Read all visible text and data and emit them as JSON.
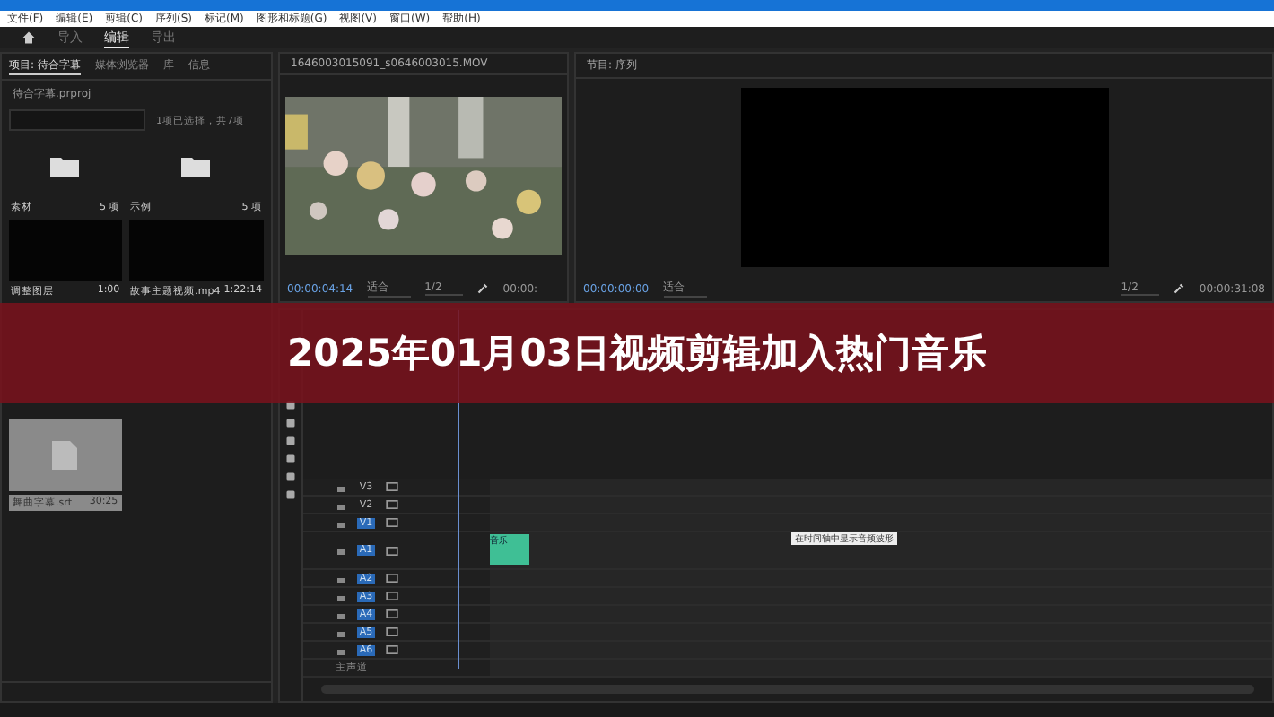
{
  "menu": [
    "文件(F)",
    "编辑(E)",
    "剪辑(C)",
    "序列(S)",
    "标记(M)",
    "图形和标题(G)",
    "视图(V)",
    "窗口(W)",
    "帮助(H)"
  ],
  "workspace_tabs": [
    {
      "label": "导入",
      "selected": false
    },
    {
      "label": "编辑",
      "selected": true
    },
    {
      "label": "导出",
      "selected": false
    }
  ],
  "project": {
    "tabs": [
      {
        "label": "项目: 待合字幕",
        "selected": true
      },
      {
        "label": "媒体浏览器",
        "selected": false
      },
      {
        "label": "库",
        "selected": false
      },
      {
        "label": "信息",
        "selected": false
      }
    ],
    "file": "待合字幕.prproj",
    "count": "1项已选择，共7项",
    "items": [
      {
        "kind": "folder",
        "name": "素材",
        "meta": "5 项"
      },
      {
        "kind": "folder",
        "name": "示例",
        "meta": "5 项"
      },
      {
        "kind": "clip",
        "name": "调整图层",
        "meta": "1:00"
      },
      {
        "kind": "clip",
        "name": "故事主题视频.mp4",
        "meta": "1:22:14"
      },
      {
        "kind": "file",
        "name": "舞曲字幕.srt",
        "meta": "30:25"
      }
    ]
  },
  "source": {
    "title": "1646003015091_s0646003015.MOV",
    "timecode": "00:00:04:14",
    "fit": "适合",
    "ratio": "1/2",
    "duration": "00:00:"
  },
  "program": {
    "title": "节目: 序列",
    "timecode": "00:00:00:00",
    "fit": "适合",
    "ratio": "1/2",
    "duration": "00:00:31:08"
  },
  "banner": "2025年01月03日视频剪辑加入热门音乐",
  "timeline": {
    "tracks": [
      {
        "name": "V3",
        "kind": "video",
        "targeted": false
      },
      {
        "name": "V2",
        "kind": "video",
        "targeted": false
      },
      {
        "name": "V1",
        "kind": "video",
        "targeted": true
      },
      {
        "name": "A1",
        "kind": "audio",
        "targeted": true,
        "clip": "音乐"
      },
      {
        "name": "A2",
        "kind": "audio",
        "targeted": true
      },
      {
        "name": "A3",
        "kind": "audio",
        "targeted": true
      },
      {
        "name": "A4",
        "kind": "audio",
        "targeted": true
      },
      {
        "name": "A5",
        "kind": "audio",
        "targeted": true
      },
      {
        "name": "A6",
        "kind": "audio",
        "targeted": true
      }
    ],
    "master": "主声道",
    "tooltip": "在时间轴中显示音频波形"
  }
}
